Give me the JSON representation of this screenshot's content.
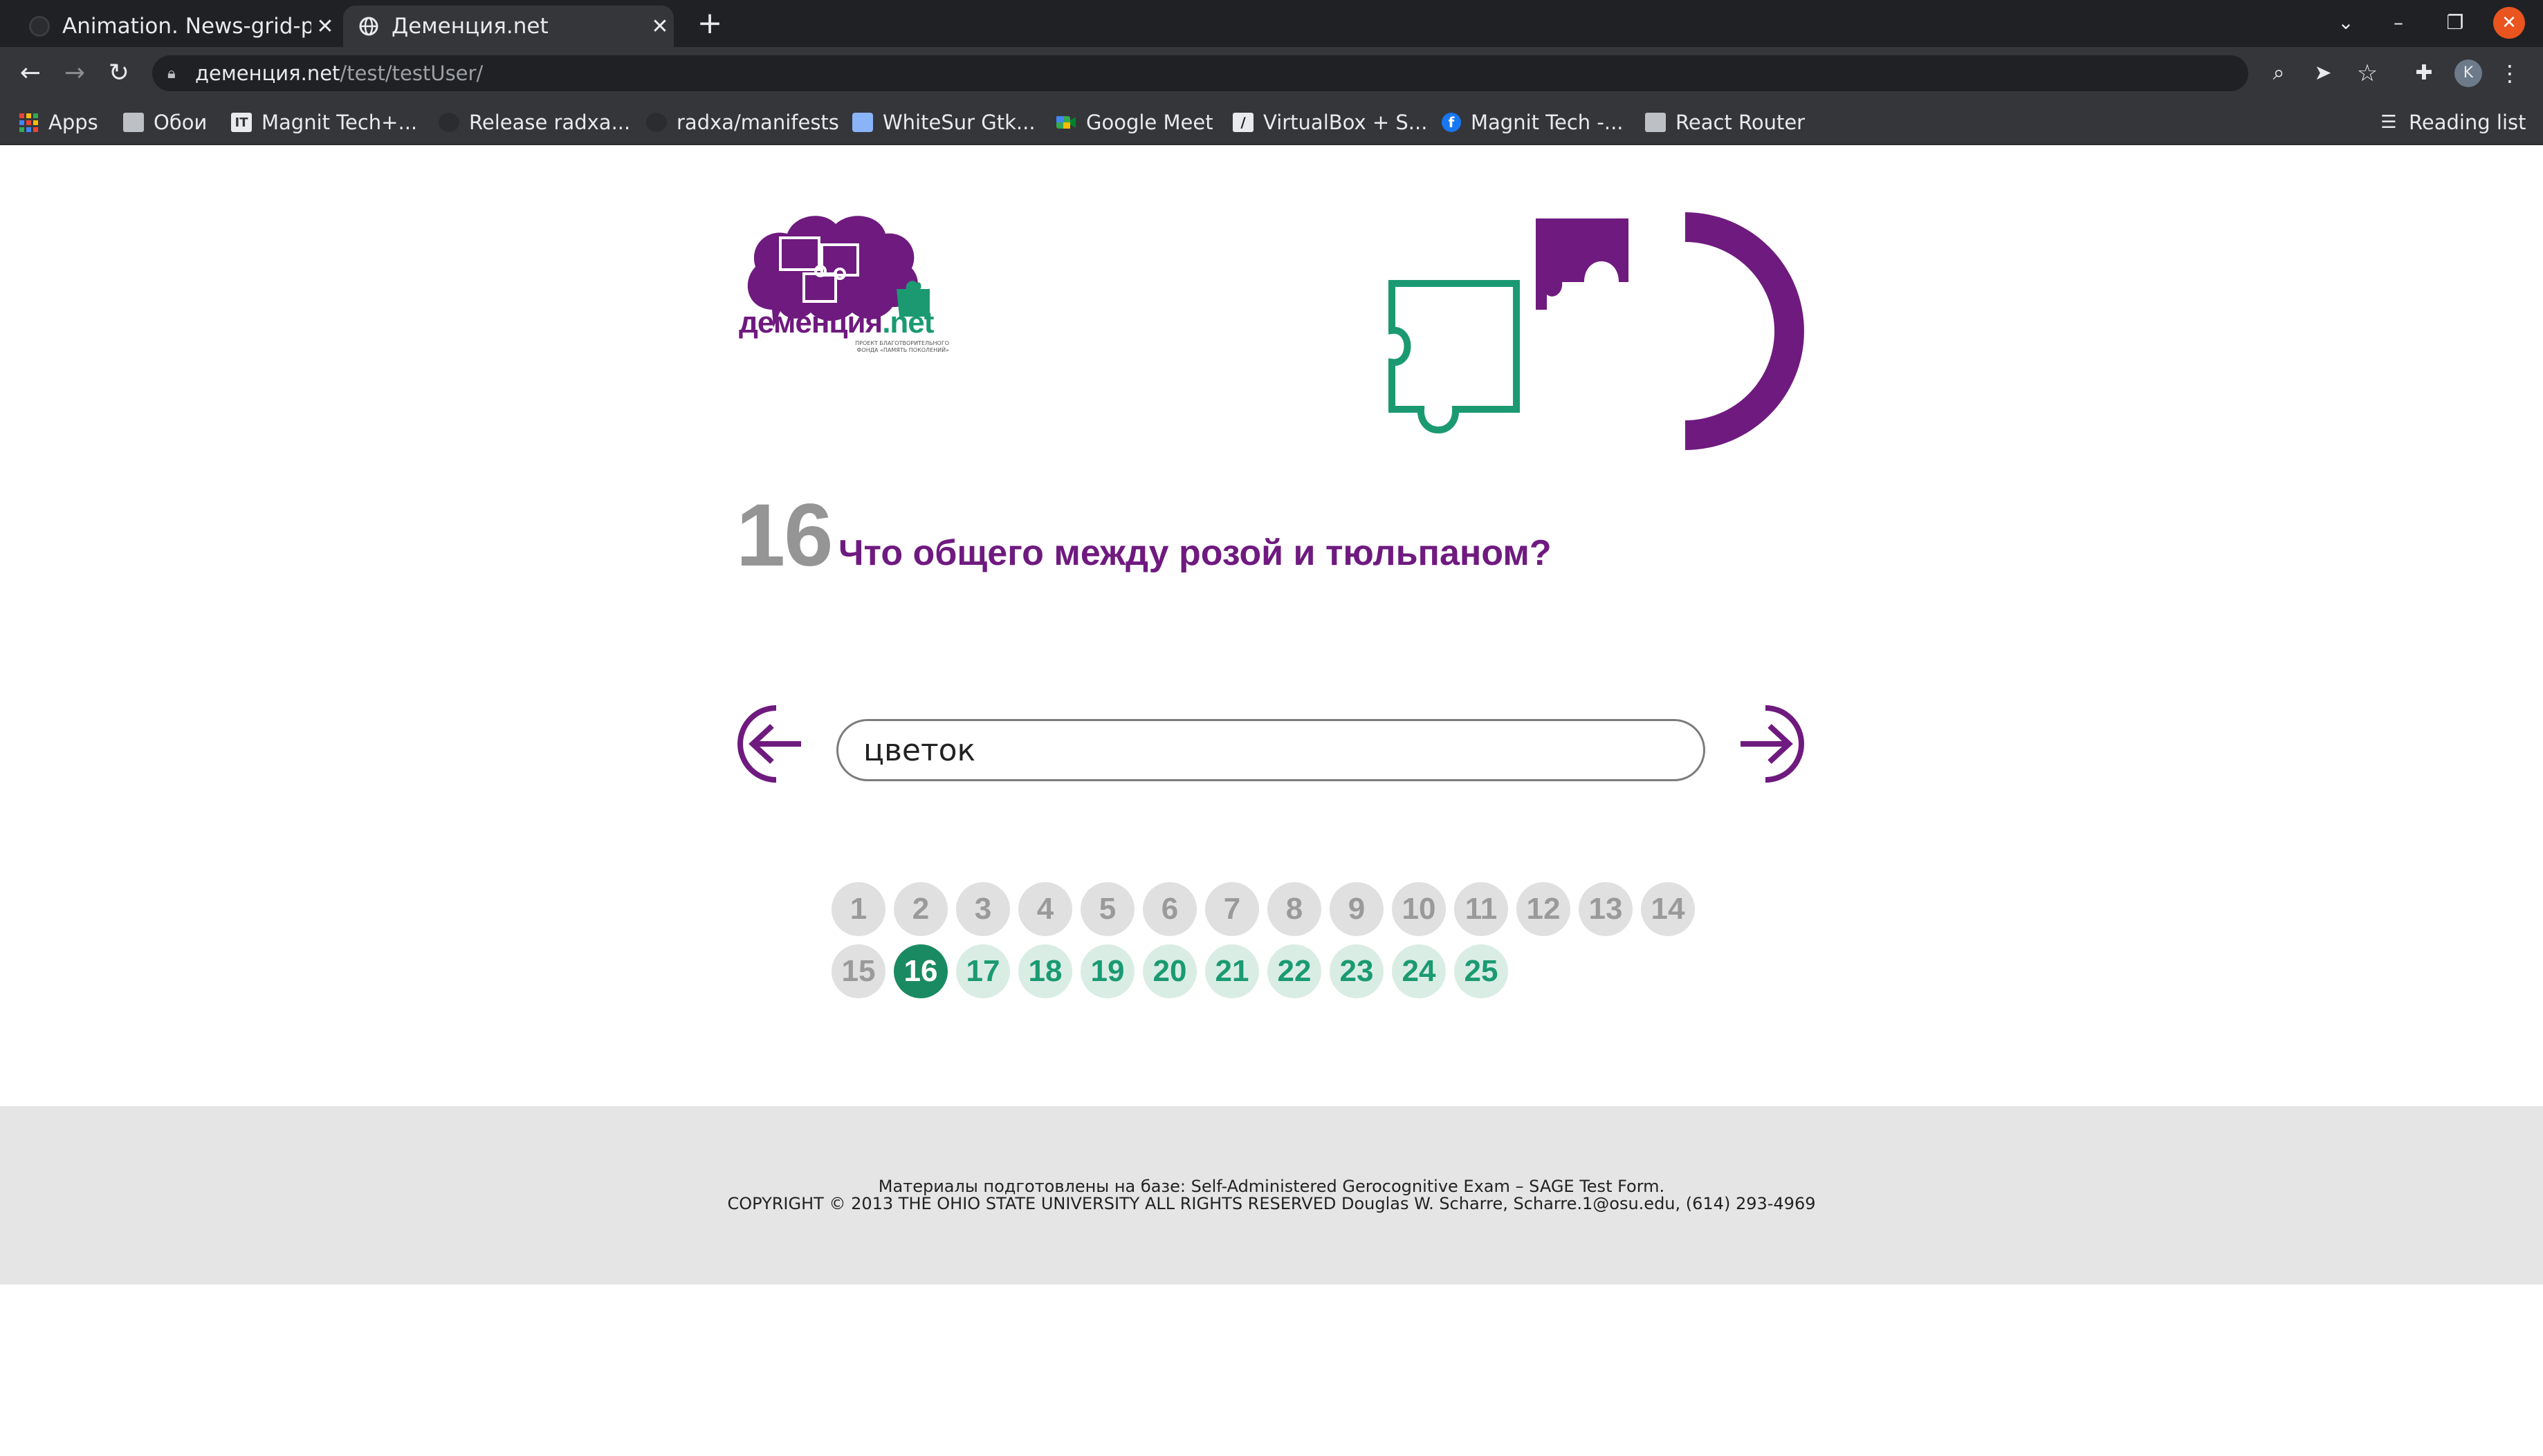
{
  "browser": {
    "tabs": [
      {
        "title": "Animation. News-grid-page",
        "active": false
      },
      {
        "title": "Деменция.net",
        "active": true
      }
    ],
    "new_tab_label": "+",
    "url_host": "деменция.net",
    "url_path": "/test/testUser/",
    "profile_initial": "K",
    "bookmarks": [
      {
        "label": "Apps",
        "icon": "apps-grid-icon"
      },
      {
        "label": "Обои",
        "icon": "folder-icon"
      },
      {
        "label": "Magnit Tech+...",
        "icon": "it-icon"
      },
      {
        "label": "Release radxa...",
        "icon": "github-icon"
      },
      {
        "label": "radxa/manifests",
        "icon": "github-icon"
      },
      {
        "label": "WhiteSur Gtk...",
        "icon": "theme-icon"
      },
      {
        "label": "Google Meet",
        "icon": "meet-icon"
      },
      {
        "label": "VirtualBox + S...",
        "icon": "vbox-icon"
      },
      {
        "label": "Magnit Tech -...",
        "icon": "facebook-icon"
      },
      {
        "label": "React Router",
        "icon": "folder-icon"
      }
    ],
    "reading_list_label": "Reading list"
  },
  "site": {
    "logo_text": "деменция",
    "logo_text_accent": ".net",
    "logo_subtitle": "ПРОЕКТ БЛАГОТВОРИТЕЛЬНОГО ФОНДА «ПАМЯТЬ ПОКОЛЕНИЙ»"
  },
  "question": {
    "number": "16",
    "text": "Что общего между розой и тюльпаном?",
    "answer_value": "цветок"
  },
  "pager": {
    "pages": [
      "1",
      "2",
      "3",
      "4",
      "5",
      "6",
      "7",
      "8",
      "9",
      "10",
      "11",
      "12",
      "13",
      "14",
      "15",
      "16",
      "17",
      "18",
      "19",
      "20",
      "21",
      "22",
      "23",
      "24",
      "25"
    ],
    "current": 16,
    "completed_through": 15
  },
  "footer": {
    "line1": "Материалы подготовлены на базе: Self-Administered Gerocognitive Exam – SAGE Test Form.",
    "line2": "COPYRIGHT © 2013 THE OHIO STATE UNIVERSITY ALL RIGHTS RESERVED Douglas W. Scharre, Scharre.1@osu.edu, (614) 293-4969"
  },
  "colors": {
    "brand_purple": "#6f1a7f",
    "brand_green": "#1b9a72",
    "current_page": "#1a8a62"
  }
}
